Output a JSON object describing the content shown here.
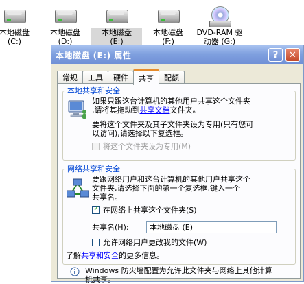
{
  "desktop": {
    "drives": [
      {
        "label": "本地磁盘",
        "sub": "(C:)"
      },
      {
        "label": "本地磁盘",
        "sub": "(D:)"
      },
      {
        "label": "本地磁盘",
        "sub": "(E:)"
      },
      {
        "label": "本地磁盘",
        "sub": "(F:)"
      },
      {
        "label": "DVD-RAM 驱",
        "sub": "动器 (G:)"
      }
    ]
  },
  "dialog": {
    "title": "本地磁盘 (E:) 属性",
    "help_label": "?",
    "close_label": "✕",
    "tabs": [
      "常规",
      "工具",
      "硬件",
      "共享",
      "配额"
    ],
    "local": {
      "title": "本地共享和安全",
      "line1": "如果只跟这台计算机的其他用户共享这个文件夹",
      "line2_pre": ",请将其拖动到",
      "line2_link": "共享文档",
      "line2_post": "文件夹。",
      "line3": "要将这个文件夹及其子文件夹设为专用(只有您可",
      "line4": "以访问),请选择以下复选框。",
      "private_label": "将这个文件夹设为专用(M)"
    },
    "network": {
      "title": "网络共享和安全",
      "line1": "要跟网络用户和这台计算机的其他用户共享这个",
      "line2": "文件夹,请选择下面的第一个复选框,键入一个",
      "line3": "共享名。",
      "share_label": "在网络上共享这个文件夹(S)",
      "share_name_label": "共享名(H):",
      "share_name_value": "本地磁盘 (E)",
      "allow_change_label": "允许网络用户更改我的文件(W)",
      "learn_pre": "了解",
      "learn_link": "共享和安全",
      "learn_post": "的更多信息。"
    },
    "firewall": {
      "line1": "Windows 防火墙配置为允许此文件夹与网络上其他计算",
      "line2": "机共享。"
    }
  }
}
